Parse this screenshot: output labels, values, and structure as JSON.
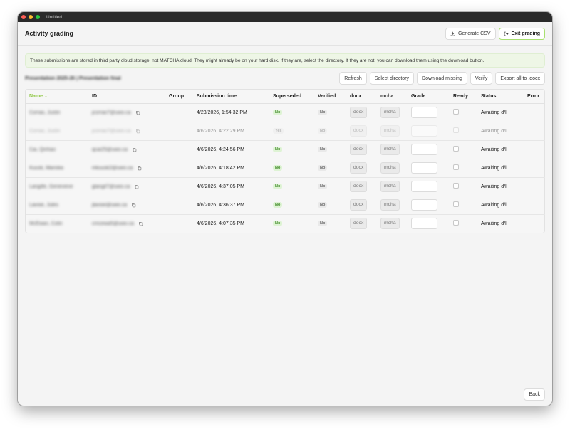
{
  "window": {
    "title": "Untitled"
  },
  "header": {
    "title": "Activity grading",
    "generate_csv": "Generate CSV",
    "exit_grading": "Exit grading"
  },
  "notice": "These submissions are stored in third party cloud storage, not MATCHA cloud. They might already be on your hard disk. If they are, select the directory. If they are not, you can download them using the download button.",
  "toolbar": {
    "assignment_title": "Presentation 2025-26 | Presentation final",
    "refresh": "Refresh",
    "select_directory": "Select directory",
    "download_missing": "Download missing",
    "verify": "Verify",
    "export_all": "Export all to .docx"
  },
  "table": {
    "columns": {
      "name": "Name",
      "id": "ID",
      "group": "Group",
      "submission_time": "Submission time",
      "superseded": "Superseded",
      "verified": "Verified",
      "docx": "docx",
      "mcha": "mcha",
      "grade": "Grade",
      "ready": "Ready",
      "status": "Status",
      "error": "Error"
    },
    "sort_indicator": "▲",
    "rows": [
      {
        "name": "Corrao, Justin",
        "id": "jcorrao7@uwo.ca",
        "group": "",
        "time": "4/23/2026, 1:54:32 PM",
        "superseded": "No",
        "verified": "No",
        "docx": "docx",
        "mcha": "mcha",
        "grade": "",
        "status": "Awaiting d/l",
        "error": "",
        "faded": false
      },
      {
        "name": "Corrao, Justin",
        "id": "jcorrao7@uwo.ca",
        "group": "",
        "time": "4/6/2026, 4:22:29 PM",
        "superseded": "Yes",
        "verified": "No",
        "docx": "docx",
        "mcha": "mcha",
        "grade": "",
        "status": "Awaiting d/l",
        "error": "",
        "faded": true
      },
      {
        "name": "Cai, Qinhao",
        "id": "qcai25@uwo.ca",
        "group": "",
        "time": "4/6/2026, 4:24:56 PM",
        "superseded": "No",
        "verified": "No",
        "docx": "docx",
        "mcha": "mcha",
        "grade": "",
        "status": "Awaiting d/l",
        "error": "",
        "faded": false
      },
      {
        "name": "Kuusk, Mariska",
        "id": "mkuusk2@uwo.ca",
        "group": "",
        "time": "4/6/2026, 4:18:42 PM",
        "superseded": "No",
        "verified": "No",
        "docx": "docx",
        "mcha": "mcha",
        "grade": "",
        "status": "Awaiting d/l",
        "error": "",
        "faded": false
      },
      {
        "name": "Langille, Genevieve",
        "id": "glangil7@uwo.ca",
        "group": "",
        "time": "4/6/2026, 4:37:05 PM",
        "superseded": "No",
        "verified": "No",
        "docx": "docx",
        "mcha": "mcha",
        "grade": "",
        "status": "Awaiting d/l",
        "error": "",
        "faded": false
      },
      {
        "name": "Lavoie, Jules",
        "id": "jlavoie@uwo.ca",
        "group": "",
        "time": "4/6/2026, 4:36:37 PM",
        "superseded": "No",
        "verified": "No",
        "docx": "docx",
        "mcha": "mcha",
        "grade": "",
        "status": "Awaiting d/l",
        "error": "",
        "faded": false
      },
      {
        "name": "McEwan, Colin",
        "id": "cmcewa5@uwo.ca",
        "group": "",
        "time": "4/6/2026, 4:07:35 PM",
        "superseded": "No",
        "verified": "No",
        "docx": "docx",
        "mcha": "mcha",
        "grade": "",
        "status": "Awaiting d/l",
        "error": "",
        "faded": false
      }
    ]
  },
  "footer": {
    "back": "Back"
  },
  "colors": {
    "accent": "#8cc63f",
    "notice_bg": "#eef6e6",
    "titlebar": "#2a2a2a"
  }
}
